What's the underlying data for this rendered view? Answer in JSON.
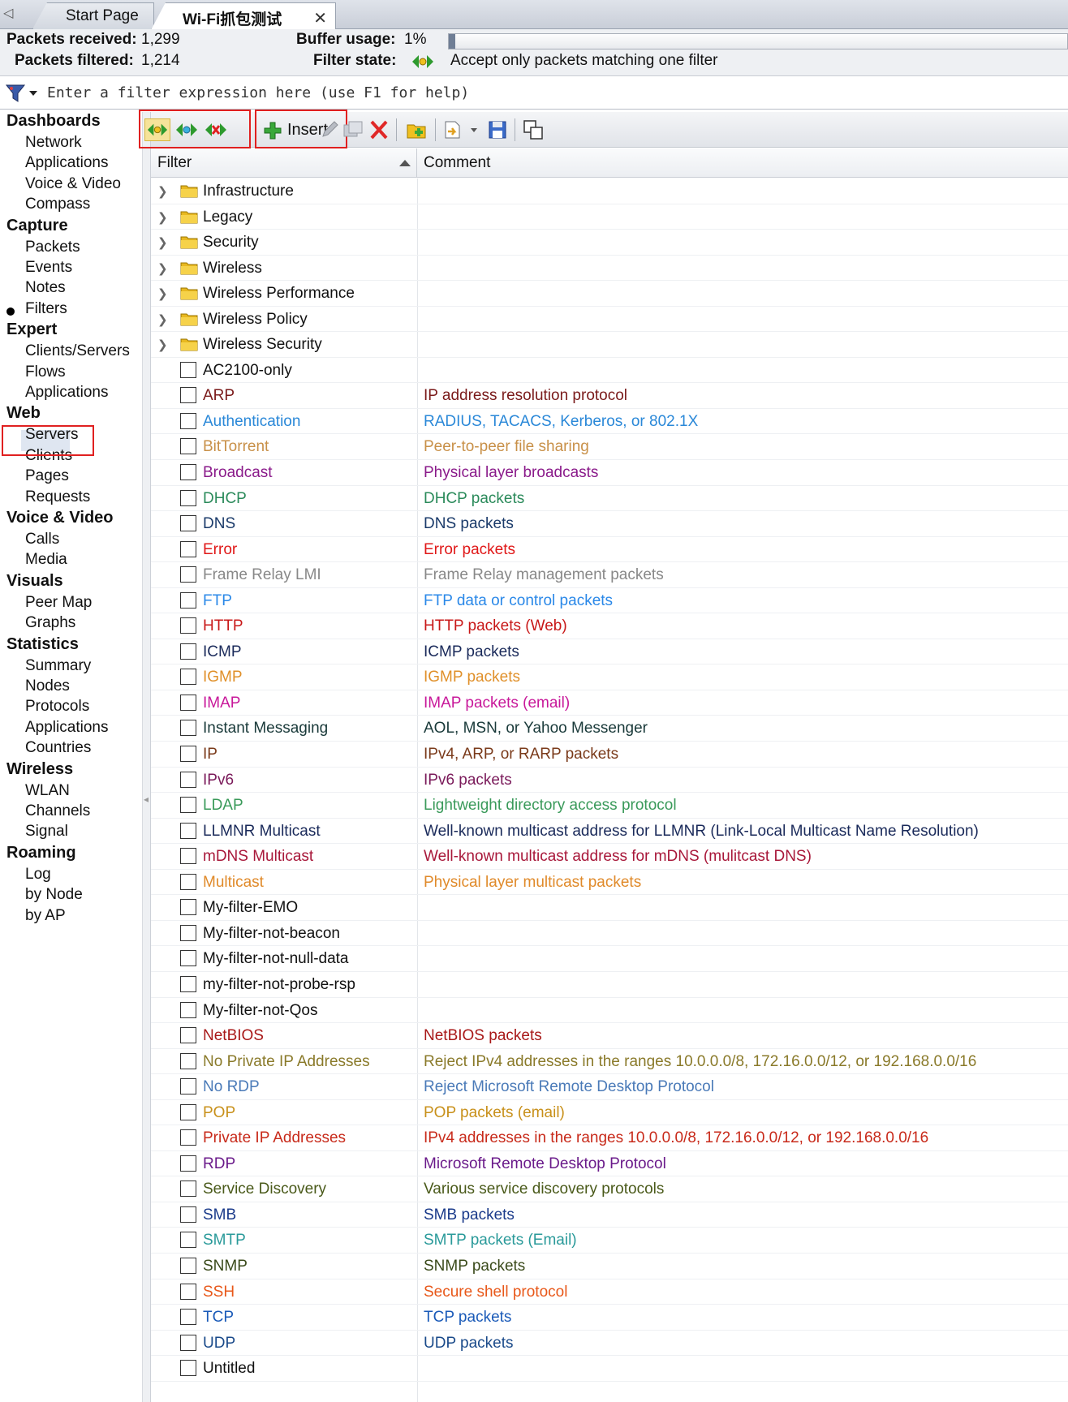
{
  "tabs": {
    "scroll": "◁",
    "start_page": "Start Page",
    "active": "Wi-Fi抓包测试",
    "close": "✕"
  },
  "status": {
    "packets_received_label": "Packets received:",
    "packets_received": "1,299",
    "packets_filtered_label": "Packets filtered:",
    "packets_filtered": "1,214",
    "buffer_usage_label": "Buffer usage:",
    "buffer_usage": "1%",
    "buffer_fraction": 0.01,
    "filter_state_label": "Filter state:",
    "filter_state": "Accept only packets matching one filter"
  },
  "expression": {
    "placeholder": "Enter a filter expression here (use F1 for help)"
  },
  "sidebar": {
    "sections": [
      {
        "label": "Dashboards",
        "items": [
          "Network",
          "Applications",
          "Voice & Video",
          "Compass"
        ]
      },
      {
        "label": "Capture",
        "items": [
          "Packets",
          "Events",
          "Notes",
          "Filters"
        ]
      },
      {
        "label": "Expert",
        "items": [
          "Clients/Servers",
          "Flows",
          "Applications"
        ]
      },
      {
        "label": "Web",
        "items": [
          "Servers",
          "Clients",
          "Pages",
          "Requests"
        ]
      },
      {
        "label": "Voice & Video",
        "items": [
          "Calls",
          "Media"
        ]
      },
      {
        "label": "Visuals",
        "items": [
          "Peer Map",
          "Graphs"
        ]
      },
      {
        "label": "Statistics",
        "items": [
          "Summary",
          "Nodes",
          "Protocols",
          "Applications",
          "Countries"
        ]
      },
      {
        "label": "Wireless",
        "items": [
          "WLAN",
          "Channels",
          "Signal"
        ]
      },
      {
        "label": "Roaming",
        "items": [
          "Log",
          "by Node",
          "by AP"
        ]
      }
    ],
    "selected": "Filters"
  },
  "toolbar": {
    "insert_label": "Insert"
  },
  "table": {
    "columns": {
      "filter": "Filter",
      "comment": "Comment"
    },
    "rows": [
      {
        "type": "folder",
        "name": "Infrastructure",
        "comment": "",
        "color": "#111111"
      },
      {
        "type": "folder",
        "name": "Legacy",
        "comment": "",
        "color": "#111111"
      },
      {
        "type": "folder",
        "name": "Security",
        "comment": "",
        "color": "#111111"
      },
      {
        "type": "folder",
        "name": "Wireless",
        "comment": "",
        "color": "#111111"
      },
      {
        "type": "folder",
        "name": "Wireless Performance",
        "comment": "",
        "color": "#111111"
      },
      {
        "type": "folder",
        "name": "Wireless Policy",
        "comment": "",
        "color": "#111111"
      },
      {
        "type": "folder",
        "name": "Wireless Security",
        "comment": "",
        "color": "#111111"
      },
      {
        "type": "filter",
        "name": "AC2100-only",
        "comment": "",
        "color": "#111111"
      },
      {
        "type": "filter",
        "name": "ARP",
        "comment": "IP address resolution protocol",
        "color": "#7a1a1a"
      },
      {
        "type": "filter",
        "name": "Authentication",
        "comment": "RADIUS, TACACS, Kerberos, or 802.1X",
        "color": "#2a88d8"
      },
      {
        "type": "filter",
        "name": "BitTorrent",
        "comment": "Peer-to-peer file sharing",
        "color": "#c89048"
      },
      {
        "type": "filter",
        "name": "Broadcast",
        "comment": "Physical layer broadcasts",
        "color": "#8a1a8a"
      },
      {
        "type": "filter",
        "name": "DHCP",
        "comment": "DHCP packets",
        "color": "#2a8a5a"
      },
      {
        "type": "filter",
        "name": "DNS",
        "comment": "DNS packets",
        "color": "#1a3a6a"
      },
      {
        "type": "filter",
        "name": "Error",
        "comment": "Error packets",
        "color": "#e01818"
      },
      {
        "type": "filter",
        "name": "Frame Relay LMI",
        "comment": "Frame Relay management packets",
        "color": "#888888"
      },
      {
        "type": "filter",
        "name": "FTP",
        "comment": "FTP data or control packets",
        "color": "#2a88e8"
      },
      {
        "type": "filter",
        "name": "HTTP",
        "comment": "HTTP packets (Web)",
        "color": "#c81818"
      },
      {
        "type": "filter",
        "name": "ICMP",
        "comment": "ICMP packets",
        "color": "#1a2a5a"
      },
      {
        "type": "filter",
        "name": "IGMP",
        "comment": "IGMP packets",
        "color": "#e0902a"
      },
      {
        "type": "filter",
        "name": "IMAP",
        "comment": "IMAP packets (email)",
        "color": "#c8189a"
      },
      {
        "type": "filter",
        "name": "Instant Messaging",
        "comment": "AOL, MSN, or Yahoo Messenger",
        "color": "#1a3a3a"
      },
      {
        "type": "filter",
        "name": "IP",
        "comment": "IPv4, ARP, or RARP packets",
        "color": "#7a3a1a"
      },
      {
        "type": "filter",
        "name": "IPv6",
        "comment": "IPv6 packets",
        "color": "#7a1a5a"
      },
      {
        "type": "filter",
        "name": "LDAP",
        "comment": "Lightweight directory access protocol",
        "color": "#3a9a5a"
      },
      {
        "type": "filter",
        "name": "LLMNR Multicast",
        "comment": "Well-known multicast address for LLMNR (Link-Local Multicast Name Resolution)",
        "color": "#1a2a5a"
      },
      {
        "type": "filter",
        "name": "mDNS Multicast",
        "comment": "Well-known multicast address for mDNS (mulitcast DNS)",
        "color": "#a8183a"
      },
      {
        "type": "filter",
        "name": "Multicast",
        "comment": "Physical layer multicast packets",
        "color": "#e08a2a"
      },
      {
        "type": "filter",
        "name": "My-filter-EMO",
        "comment": "",
        "color": "#111111"
      },
      {
        "type": "filter",
        "name": "My-filter-not-beacon",
        "comment": "",
        "color": "#111111"
      },
      {
        "type": "filter",
        "name": "My-filter-not-null-data",
        "comment": "",
        "color": "#111111"
      },
      {
        "type": "filter",
        "name": "my-filter-not-probe-rsp",
        "comment": "",
        "color": "#111111"
      },
      {
        "type": "filter",
        "name": "My-filter-not-Qos",
        "comment": "",
        "color": "#111111"
      },
      {
        "type": "filter",
        "name": "NetBIOS",
        "comment": "NetBIOS packets",
        "color": "#a81818"
      },
      {
        "type": "filter",
        "name": "No Private IP Addresses",
        "comment": "Reject IPv4 addresses in the ranges 10.0.0.0/8, 172.16.0.0/12, or 192.168.0.0/16",
        "color": "#8a7a2a"
      },
      {
        "type": "filter",
        "name": "No RDP",
        "comment": "Reject Microsoft Remote Desktop Protocol",
        "color": "#4a7ab8"
      },
      {
        "type": "filter",
        "name": "POP",
        "comment": "POP packets (email)",
        "color": "#c8901a"
      },
      {
        "type": "filter",
        "name": "Private IP Addresses",
        "comment": "IPv4 addresses in the ranges 10.0.0.0/8, 172.16.0.0/12, or 192.168.0.0/16",
        "color": "#c82a1a"
      },
      {
        "type": "filter",
        "name": "RDP",
        "comment": "Microsoft Remote Desktop Protocol",
        "color": "#6a1a8a"
      },
      {
        "type": "filter",
        "name": "Service Discovery",
        "comment": "Various service discovery protocols",
        "color": "#4a5a1a"
      },
      {
        "type": "filter",
        "name": "SMB",
        "comment": "SMB packets",
        "color": "#1a3a8a"
      },
      {
        "type": "filter",
        "name": "SMTP",
        "comment": "SMTP packets (Email)",
        "color": "#2a9a9a"
      },
      {
        "type": "filter",
        "name": "SNMP",
        "comment": "SNMP packets",
        "color": "#3a4a1a"
      },
      {
        "type": "filter",
        "name": "SSH",
        "comment": "Secure shell protocol",
        "color": "#e8581a"
      },
      {
        "type": "filter",
        "name": "TCP",
        "comment": "TCP packets",
        "color": "#1a5ab8"
      },
      {
        "type": "filter",
        "name": "UDP",
        "comment": "UDP packets",
        "color": "#1a4a8a"
      },
      {
        "type": "filter",
        "name": "Untitled",
        "comment": "",
        "color": "#111111"
      }
    ]
  }
}
